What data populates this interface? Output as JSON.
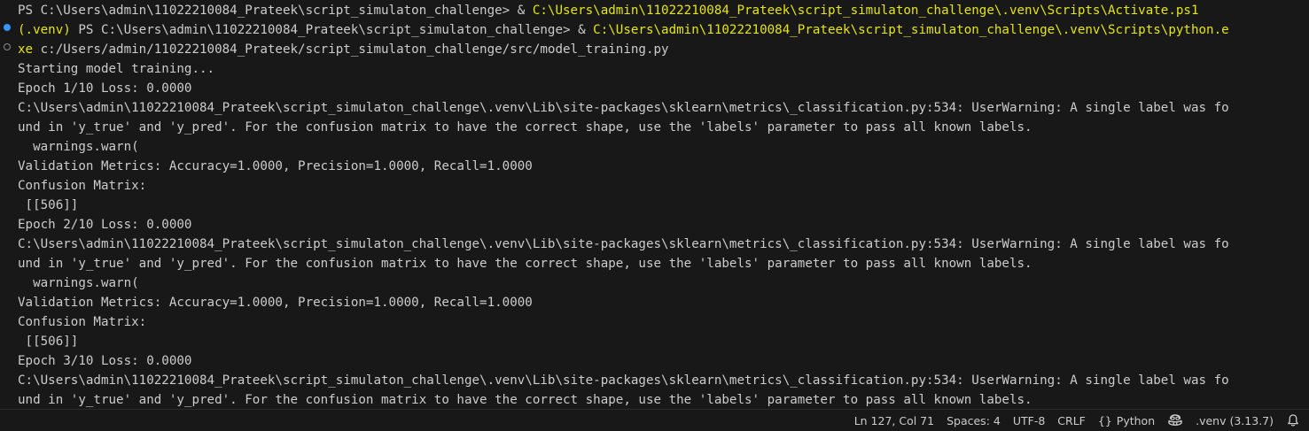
{
  "terminal": {
    "cmd1": {
      "prompt": "PS C:\\Users\\admin\\11022210084_Prateek\\script_simulaton_challenge> & ",
      "path": "C:\\Users\\admin\\11022210084_Prateek\\script_simulaton_challenge\\.venv\\Scripts\\Activate.ps1"
    },
    "cmd2": {
      "venv": "(.venv)",
      "prompt": " PS C:\\Users\\admin\\11022210084_Prateek\\script_simulaton_challenge> & ",
      "exe_a": "C:\\Users\\admin\\11022210084_Prateek\\script_simulaton_challenge\\.venv\\Scripts\\python.e",
      "exe_b": "xe",
      "script": " c:/Users/admin/11022210084_Prateek/script_simulaton_challenge/src/model_training.py"
    },
    "output": [
      "Starting model training...",
      "Epoch 1/10 Loss: 0.0000",
      "C:\\Users\\admin\\11022210084_Prateek\\script_simulaton_challenge\\.venv\\Lib\\site-packages\\sklearn\\metrics\\_classification.py:534: UserWarning: A single label was fo",
      "und in 'y_true' and 'y_pred'. For the confusion matrix to have the correct shape, use the 'labels' parameter to pass all known labels.",
      "  warnings.warn(",
      "Validation Metrics: Accuracy=1.0000, Precision=1.0000, Recall=1.0000",
      "Confusion Matrix:",
      " [[506]]",
      "Epoch 2/10 Loss: 0.0000",
      "C:\\Users\\admin\\11022210084_Prateek\\script_simulaton_challenge\\.venv\\Lib\\site-packages\\sklearn\\metrics\\_classification.py:534: UserWarning: A single label was fo",
      "und in 'y_true' and 'y_pred'. For the confusion matrix to have the correct shape, use the 'labels' parameter to pass all known labels.",
      "  warnings.warn(",
      "Validation Metrics: Accuracy=1.0000, Precision=1.0000, Recall=1.0000",
      "Confusion Matrix:",
      " [[506]]",
      "Epoch 3/10 Loss: 0.0000",
      "C:\\Users\\admin\\11022210084_Prateek\\script_simulaton_challenge\\.venv\\Lib\\site-packages\\sklearn\\metrics\\_classification.py:534: UserWarning: A single label was fo",
      "und in 'y_true' and 'y_pred'. For the confusion matrix to have the correct shape, use the 'labels' parameter to pass all known labels."
    ]
  },
  "statusbar": {
    "position": "Ln 127, Col 71",
    "spaces": "Spaces: 4",
    "encoding": "UTF-8",
    "eol": "CRLF",
    "braces": "{}",
    "language": "Python",
    "interpreter": ".venv (3.13.7)"
  },
  "colors": {
    "background": "#181818",
    "text": "#cccccc",
    "path_highlight": "#e5e510",
    "decoration_success": "#3794ff"
  },
  "icons": {
    "copilot": "copilot-icon",
    "notifications": "bell-icon"
  }
}
